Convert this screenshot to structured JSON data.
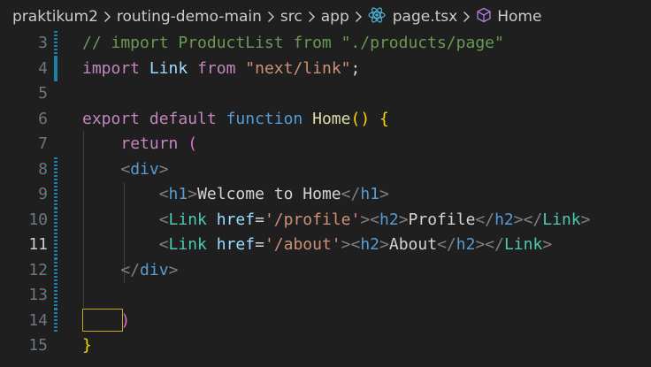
{
  "breadcrumb": {
    "items": [
      "praktikum2",
      "routing-demo-main",
      "src",
      "app",
      "page.tsx",
      "Home"
    ],
    "icons": [
      "react-icon",
      "symbol-method-icon"
    ]
  },
  "editor": {
    "active_line": "11",
    "lines": [
      {
        "num": "3",
        "tokens": [
          {
            "c": "tk-comment",
            "t": "// import ProductList from \"./products/page\""
          }
        ]
      },
      {
        "num": "4",
        "tokens": [
          {
            "c": "tk-keyword",
            "t": "import"
          },
          {
            "c": "tk-text",
            "t": " "
          },
          {
            "c": "tk-var",
            "t": "Link"
          },
          {
            "c": "tk-text",
            "t": " "
          },
          {
            "c": "tk-keyword",
            "t": "from"
          },
          {
            "c": "tk-text",
            "t": " "
          },
          {
            "c": "tk-string",
            "t": "\"next/link\""
          },
          {
            "c": "tk-text",
            "t": ";"
          }
        ]
      },
      {
        "num": "5",
        "tokens": []
      },
      {
        "num": "6",
        "tokens": [
          {
            "c": "tk-keyword",
            "t": "export"
          },
          {
            "c": "tk-text",
            "t": " "
          },
          {
            "c": "tk-keyword",
            "t": "default"
          },
          {
            "c": "tk-text",
            "t": " "
          },
          {
            "c": "tk-storage",
            "t": "function"
          },
          {
            "c": "tk-text",
            "t": " "
          },
          {
            "c": "tk-func",
            "t": "Home"
          },
          {
            "c": "tk-brace-gold",
            "t": "()"
          },
          {
            "c": "tk-text",
            "t": " "
          },
          {
            "c": "tk-brace-gold",
            "t": "{"
          }
        ]
      },
      {
        "num": "7",
        "tokens": [
          {
            "c": "tk-text",
            "t": "    "
          },
          {
            "c": "tk-keyword",
            "t": "return"
          },
          {
            "c": "tk-text",
            "t": " "
          },
          {
            "c": "tk-brace-pink",
            "t": "("
          }
        ]
      },
      {
        "num": "8",
        "tokens": [
          {
            "c": "tk-text",
            "t": "    "
          },
          {
            "c": "tk-tagpunct",
            "t": "<"
          },
          {
            "c": "tk-tag",
            "t": "div"
          },
          {
            "c": "tk-tagpunct",
            "t": ">"
          }
        ]
      },
      {
        "num": "9",
        "tokens": [
          {
            "c": "tk-text",
            "t": "        "
          },
          {
            "c": "tk-tagpunct",
            "t": "<"
          },
          {
            "c": "tk-tag",
            "t": "h1"
          },
          {
            "c": "tk-tagpunct",
            "t": ">"
          },
          {
            "c": "tk-text",
            "t": "Welcome to Home"
          },
          {
            "c": "tk-tagpunct",
            "t": "</"
          },
          {
            "c": "tk-tag",
            "t": "h1"
          },
          {
            "c": "tk-tagpunct",
            "t": ">"
          }
        ]
      },
      {
        "num": "10",
        "tokens": [
          {
            "c": "tk-text",
            "t": "        "
          },
          {
            "c": "tk-tagpunct",
            "t": "<"
          },
          {
            "c": "tk-component",
            "t": "Link"
          },
          {
            "c": "tk-text",
            "t": " "
          },
          {
            "c": "tk-attr",
            "t": "href"
          },
          {
            "c": "tk-text",
            "t": "="
          },
          {
            "c": "tk-string",
            "t": "'/profile'"
          },
          {
            "c": "tk-tagpunct",
            "t": "><"
          },
          {
            "c": "tk-tag",
            "t": "h2"
          },
          {
            "c": "tk-tagpunct",
            "t": ">"
          },
          {
            "c": "tk-text",
            "t": "Profile"
          },
          {
            "c": "tk-tagpunct",
            "t": "</"
          },
          {
            "c": "tk-tag",
            "t": "h2"
          },
          {
            "c": "tk-tagpunct",
            "t": "></"
          },
          {
            "c": "tk-component",
            "t": "Link"
          },
          {
            "c": "tk-tagpunct",
            "t": ">"
          }
        ]
      },
      {
        "num": "11",
        "tokens": [
          {
            "c": "tk-text",
            "t": "        "
          },
          {
            "c": "tk-tagpunct",
            "t": "<"
          },
          {
            "c": "tk-component",
            "t": "Link"
          },
          {
            "c": "tk-text",
            "t": " "
          },
          {
            "c": "tk-attr",
            "t": "href"
          },
          {
            "c": "tk-text",
            "t": "="
          },
          {
            "c": "tk-string",
            "t": "'/about'"
          },
          {
            "c": "tk-tagpunct",
            "t": "><"
          },
          {
            "c": "tk-tag",
            "t": "h2"
          },
          {
            "c": "tk-tagpunct",
            "t": ">"
          },
          {
            "c": "tk-text",
            "t": "About"
          },
          {
            "c": "tk-tagpunct",
            "t": "</"
          },
          {
            "c": "tk-tag",
            "t": "h2"
          },
          {
            "c": "tk-tagpunct",
            "t": "></"
          },
          {
            "c": "tk-component",
            "t": "Link"
          },
          {
            "c": "tk-tagpunct",
            "t": ">"
          }
        ]
      },
      {
        "num": "12",
        "tokens": [
          {
            "c": "tk-text",
            "t": "    "
          },
          {
            "c": "tk-tagpunct",
            "t": "</"
          },
          {
            "c": "tk-tag",
            "t": "div"
          },
          {
            "c": "tk-tagpunct",
            "t": ">"
          }
        ]
      },
      {
        "num": "13",
        "tokens": []
      },
      {
        "num": "14",
        "tokens": [
          {
            "c": "tk-text",
            "t": "    "
          },
          {
            "c": "tk-brace-pink",
            "t": ")"
          }
        ]
      },
      {
        "num": "15",
        "tokens": [
          {
            "c": "tk-brace-gold",
            "t": "}"
          }
        ]
      }
    ]
  },
  "colors": {
    "background": "#1f1f1f",
    "gutter_modified": "#1b81a8",
    "cursor_box": "#c9a227"
  }
}
